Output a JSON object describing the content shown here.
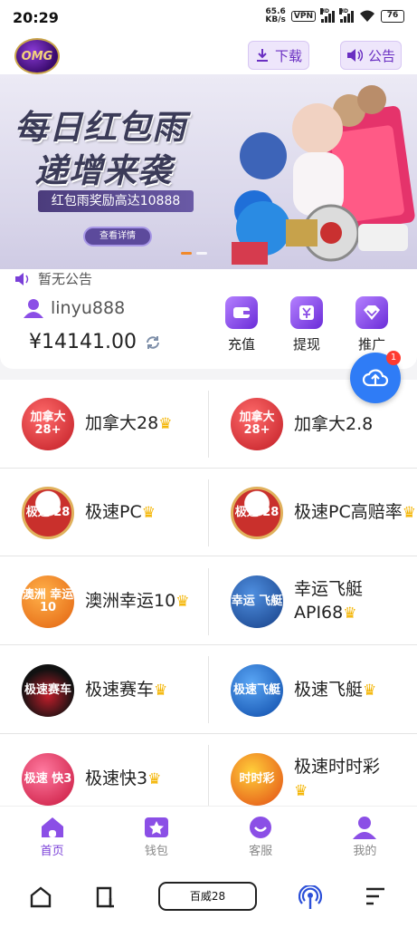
{
  "status_bar": {
    "time": "20:29",
    "speed_value": "65.6",
    "speed_unit": "KB/s",
    "vpn": "VPN",
    "battery": "76"
  },
  "header": {
    "logo_text": "OMG",
    "download_label": "下载",
    "notice_label": "公告"
  },
  "banner": {
    "title_line1": "每日红包雨",
    "title_line2": "递增来袭",
    "tag": "红包雨奖励高达10888",
    "button": "查看详情"
  },
  "notice_text": "暂无公告",
  "user": {
    "username": "linyu888",
    "balance": "¥14141.00"
  },
  "actions": [
    {
      "label": "充值",
      "icon": "wallet-icon"
    },
    {
      "label": "提现",
      "icon": "yen-icon"
    },
    {
      "label": "推广",
      "icon": "diamond-icon"
    }
  ],
  "upload_badge": "1",
  "games": [
    {
      "name": "加拿大28",
      "icon_text": "加拿大 28+",
      "color": "#d9272e"
    },
    {
      "name": "加拿大2.8",
      "icon_text": "加拿大 28+",
      "color": "#d9272e"
    },
    {
      "name": "极速PC",
      "icon_text": "极速 28",
      "color": "#c9302c"
    },
    {
      "name": "极速PC高赔率",
      "icon_text": "极速 28",
      "color": "#c9302c"
    },
    {
      "name": "澳洲幸运10",
      "icon_text": "澳洲 幸运10",
      "color": "#f07a1a"
    },
    {
      "name": "幸运飞艇API68",
      "icon_text": "幸运 飞艇",
      "color": "#1f5fb8"
    },
    {
      "name": "极速赛车",
      "icon_text": "极速赛车",
      "color": "#2b2b2b"
    },
    {
      "name": "极速飞艇",
      "icon_text": "极速飞艇",
      "color": "#1d6ed8"
    },
    {
      "name": "极速快3",
      "icon_text": "极速 快3",
      "color": "#d62f4e"
    },
    {
      "name": "极速时时彩",
      "icon_text": "时时彩",
      "color": "#e85a1b"
    }
  ],
  "bottom_nav": [
    {
      "label": "首页"
    },
    {
      "label": "钱包"
    },
    {
      "label": "客服"
    },
    {
      "label": "我的"
    }
  ],
  "system_nav": {
    "center_label": "百威28"
  },
  "colors": {
    "brand_purple": "#7a3fd8",
    "fab_blue": "#2f7cf6",
    "crown_gold": "#f4b400"
  }
}
